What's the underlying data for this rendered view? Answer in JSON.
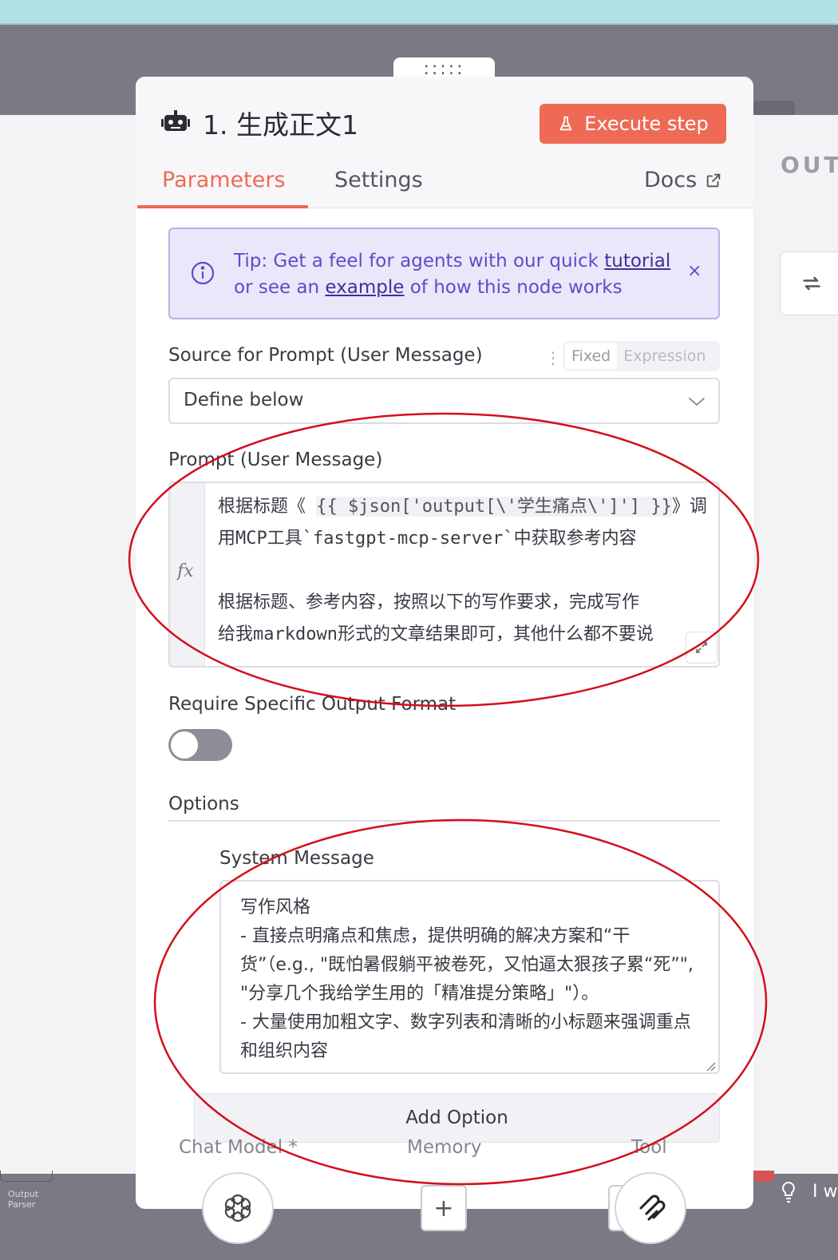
{
  "node": {
    "title": "1. 生成正文1",
    "execute_label": "Execute step"
  },
  "tabs": {
    "parameters": "Parameters",
    "settings": "Settings",
    "docs": "Docs"
  },
  "canvas": {
    "output_label": "OUT",
    "bottom_text": "I w",
    "output_parser_label": "Output Parser"
  },
  "tip": {
    "prefix": "Tip: Get a feel for agents with our quick ",
    "tutorial_link": "tutorial",
    "middle": " or see an ",
    "example_link": "example",
    "suffix": " of how this node works",
    "close": "×"
  },
  "source_prompt": {
    "label": "Source for Prompt (User Message)",
    "toggle_fixed": "Fixed",
    "toggle_expression": "Expression",
    "selected": "Define below"
  },
  "prompt": {
    "label": "Prompt (User Message)",
    "fx": "fx",
    "line1_prefix": "根据标题《 ",
    "expression": "{{ $json['output[\\'学生痛点\\']'] }}",
    "line1_suffix": "》调用MCP工具`fastgpt-mcp-server`中获取参考内容",
    "line2": "根据标题、参考内容，按照以下的写作要求，完成写作",
    "line3": "给我markdown形式的文章结果即可，其他什么都不要说"
  },
  "output_format": {
    "label": "Require Specific Output Format",
    "enabled": false
  },
  "options": {
    "label": "Options",
    "system_message_label": "System Message",
    "system_message": "写作风格\n- 直接点明痛点和焦虑，提供明确的解决方案和“干货”（e.g., \"既怕暑假躺平被卷死，又怕逼太狠孩子累“死”\", \"分享几个我给学生用的「精准提分策略」\"）。\n- 大量使用加粗文字、数字列表和清晰的小标题来强调重点和组织内容",
    "add_option": "Add Option"
  },
  "connectors": {
    "chat_model": "Chat Model *",
    "memory": "Memory",
    "tool": "Tool",
    "plus": "+"
  },
  "colors": {
    "accent": "#ee6a55",
    "tip_bg": "#eae7fb",
    "tip_text": "#5b4ec6",
    "annotation_red": "#d40f1c"
  }
}
